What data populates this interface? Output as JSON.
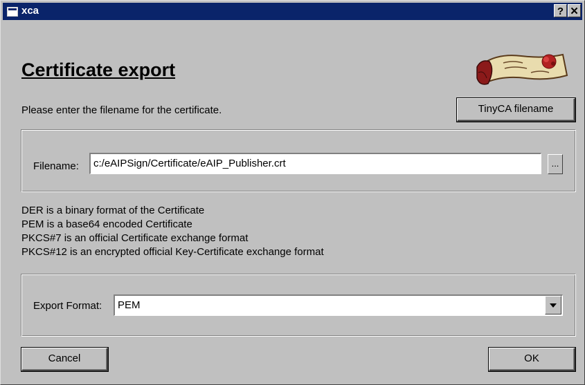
{
  "window": {
    "title": "xca",
    "help_label": "?",
    "close_label": "✕"
  },
  "heading": "Certificate export",
  "instruction": "Please enter the filename for the certificate.",
  "tinyca_button": "TinyCA filename",
  "filename": {
    "label": "Filename:",
    "value": "c:/eAIPSign/Certificate/eAIP_Publisher.crt",
    "browse_label": "..."
  },
  "format_descriptions": [
    "DER is a binary format of the Certificate",
    "PEM is a base64 encoded Certificate",
    "PKCS#7 is an official Certificate exchange format",
    "PKCS#12 is an encrypted official Key-Certificate exchange format"
  ],
  "export_format": {
    "label": "Export Format:",
    "selected": "PEM"
  },
  "buttons": {
    "cancel": "Cancel",
    "ok": "OK"
  },
  "icons": {
    "app": "window-icon",
    "logo": "certificate-scroll-icon",
    "dropdown": "chevron-down-icon"
  },
  "colors": {
    "titlebar": "#0a246a",
    "dialog": "#c0c0c0",
    "seal": "#b22222"
  }
}
